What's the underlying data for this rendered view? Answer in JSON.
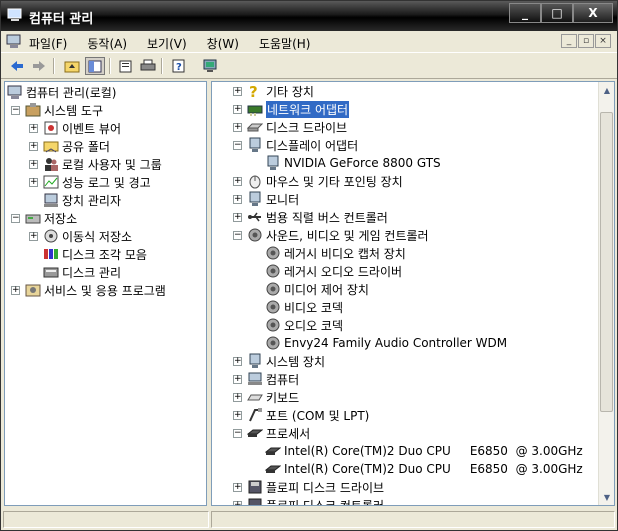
{
  "window": {
    "title": "컴퓨터 관리",
    "minimize": "_",
    "maximize": "□",
    "close": "X"
  },
  "menu": [
    "파일(F)",
    "동작(A)",
    "보기(V)",
    "창(W)",
    "도움말(H)"
  ],
  "mdi": {
    "minimize": "_",
    "restore": "▫",
    "close": "×"
  },
  "left_tree": {
    "root": "컴퓨터 관리(로컬)",
    "system_tools": "시스템 도구",
    "event_viewer": "이벤트 뷰어",
    "shared_folders": "공유 폴더",
    "local_users": "로컬 사용자 및 그룹",
    "perf_logs": "성능 로그 및 경고",
    "device_manager": "장치 관리자",
    "storage": "저장소",
    "removable_storage": "이동식 저장소",
    "defrag": "디스크 조각 모음",
    "disk_mgmt": "디스크 관리",
    "services": "서비스 및 응용 프로그램"
  },
  "right_tree": {
    "other_devices": "기타 장치",
    "network_adapters": "네트워크 어댑터",
    "disk_drives": "디스크 드라이브",
    "display_adapters": "디스플레이 어댑터",
    "gpu": "NVIDIA GeForce 8800 GTS",
    "mice": "마우스 및 기타 포인팅 장치",
    "monitors": "모니터",
    "usb": "범용 직렬 버스 컨트롤러",
    "sound": "사운드, 비디오 및 게임 컨트롤러",
    "legacy_video": "레거시 비디오 캡처 장치",
    "legacy_audio": "레거시 오디오 드라이버",
    "media_control": "미디어 제어 장치",
    "video_codecs": "비디오 코덱",
    "audio_codecs": "오디오 코덱",
    "envy24": "Envy24 Family Audio Controller WDM",
    "system_devices": "시스템 장치",
    "computer": "컴퓨터",
    "keyboards": "키보드",
    "ports": "포트 (COM 및 LPT)",
    "processors": "프로세서",
    "cpu1": "Intel(R) Core(TM)2 Duo CPU     E6850  @ 3.00GHz",
    "cpu2": "Intel(R) Core(TM)2 Duo CPU     E6850  @ 3.00GHz",
    "floppy_drives": "플로피 디스크 드라이브",
    "floppy_controllers": "플로피 디스크 컨트롤러"
  },
  "colors": {
    "selection": "#316ac5",
    "titlebar": "#000000",
    "face": "#ece9d8"
  }
}
